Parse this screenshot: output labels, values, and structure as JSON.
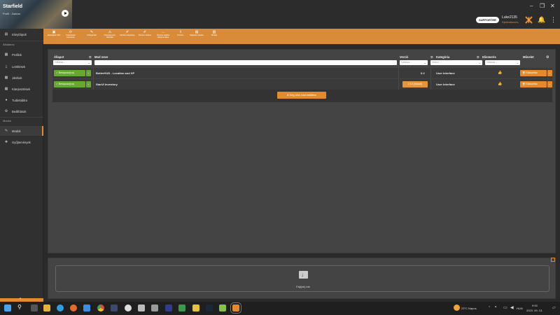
{
  "game": {
    "title": "Starfield",
    "profile": "Profil : Zadran"
  },
  "window": {
    "minimize": "–",
    "restore": "❐",
    "close": "✕"
  },
  "user": {
    "supporter_badge": "SUPPORTER",
    "name": "Luke2135",
    "tier": "Kijelentkezés"
  },
  "sidebar": {
    "top_item": "Irányítópult",
    "general_section": "Általános",
    "general_items": [
      "Profilok",
      "Letöltések",
      "Játékok",
      "Kiterjesztések",
      "Tudástáblra",
      "Beállítások"
    ],
    "mods_section": "Modok",
    "mods_items": [
      "Modok",
      "Gyűjtemények"
    ]
  },
  "toolbar": {
    "buttons": [
      {
        "icon": "▣",
        "label": "Játékfájlok felfr."
      },
      {
        "icon": "⟳",
        "label": "Frissítések keresése"
      },
      {
        "icon": "✎",
        "label": "Kategóriák"
      },
      {
        "icon": "⚠",
        "label": "Összekeverb. feloldás"
      },
      {
        "icon": "✐",
        "label": "Modok telepítése"
      },
      {
        "icon": "✐",
        "label": "Összes törlése"
      },
      {
        "icon": "↔",
        "label": "Összes letiltás kikapcsolása"
      },
      {
        "icon": "⇪",
        "label": "Közzét."
      },
      {
        "icon": "▤",
        "label": "Mappák nyitása"
      },
      {
        "icon": "▥",
        "label": "Minták"
      }
    ]
  },
  "table": {
    "headers": {
      "status": "Állapot",
      "name": "Mod neve",
      "version": "Verzió",
      "category": "Kategória",
      "endorse": "Elismerés",
      "action": "Művelet"
    },
    "filter_placeholder": "Válassz...",
    "category_placeholder": "Select...",
    "rows": [
      {
        "status": "Bekapcsol(va)",
        "name": "BetterHUD - Location and XP",
        "version": "0.2",
        "version_warning": "",
        "category": "User Interface",
        "action": "Eltávolítás"
      },
      {
        "status": "Bekapcsol(va)",
        "name": "StarUI Inventory",
        "version": "",
        "version_warning": "2.3.2 (elavult)",
        "category": "User Interface",
        "action": "Eltávolítás"
      }
    ],
    "more_button": "Még több mod betöltése"
  },
  "dropzone": {
    "label": "Fájl(ok) ide"
  },
  "taskbar": {
    "weather": "23°C Napos",
    "language": "HUN",
    "time": "9:53",
    "date": "2023. 09. 13."
  },
  "colors": {
    "accent": "#e38b2c",
    "enabled": "#66a830",
    "panel": "#444444"
  }
}
